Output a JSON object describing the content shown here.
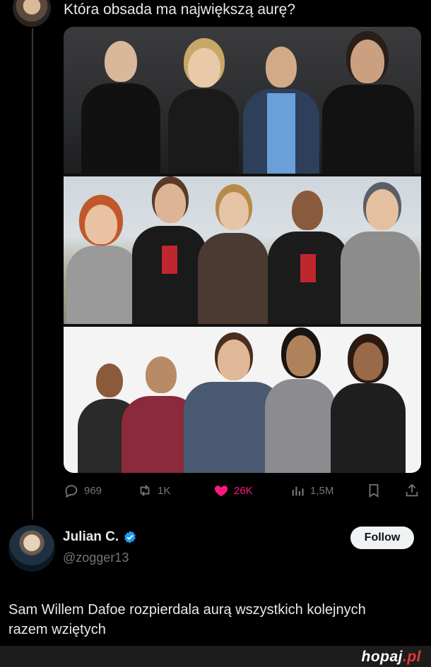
{
  "post": {
    "text": "Która obsada ma największą aurę?",
    "stats": {
      "replies": "969",
      "reposts": "1K",
      "likes": "26K",
      "views": "1,5M"
    },
    "icons": [
      "reply-icon",
      "repost-icon",
      "like-icon",
      "views-icon",
      "bookmark-icon",
      "share-icon"
    ],
    "colors": {
      "like": "#f91880",
      "muted": "#71767b",
      "verified": "#1d9bf0"
    }
  },
  "reply": {
    "name": "Julian C.",
    "handle": "@zogger13",
    "follow_label": "Follow",
    "text": "Sam Willem Dafoe rozpierdala aurą wszystkich kolejnych razem wziętych"
  },
  "watermark": {
    "brand": "hopaj",
    "tld": ".pl"
  }
}
